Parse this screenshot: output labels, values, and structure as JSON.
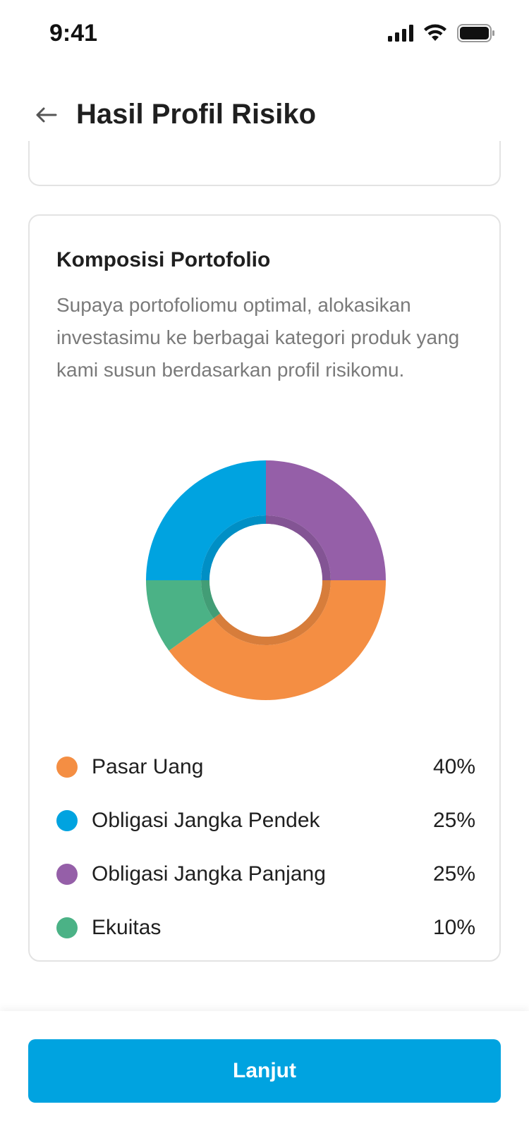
{
  "status_bar": {
    "time": "9:41",
    "icons": [
      "signal-icon",
      "wifi-icon",
      "battery-icon"
    ]
  },
  "header": {
    "back_icon": "arrow-left-icon",
    "title": "Hasil Profil Risiko"
  },
  "portfolio_card": {
    "title": "Komposisi Portofolio",
    "description": "Supaya portofoliomu optimal, alokasikan investasimu ke berbagai kategori produk yang kami susun berdasarkan profil risikomu."
  },
  "chart_data": {
    "type": "pie",
    "variant": "donut",
    "series": [
      {
        "name": "Pasar Uang",
        "value": 40,
        "label": "40%",
        "color": "#f48e43"
      },
      {
        "name": "Obligasi Jangka Pendek",
        "value": 25,
        "label": "25%",
        "color": "#00a3e0"
      },
      {
        "name": "Obligasi Jangka Panjang",
        "value": 25,
        "label": "25%",
        "color": "#955fa8"
      },
      {
        "name": "Ekuitas",
        "value": 10,
        "label": "10%",
        "color": "#4bb286"
      }
    ],
    "legend_position": "bottom"
  },
  "footer": {
    "cta_label": "Lanjut",
    "accent_color": "#00a3e0"
  }
}
